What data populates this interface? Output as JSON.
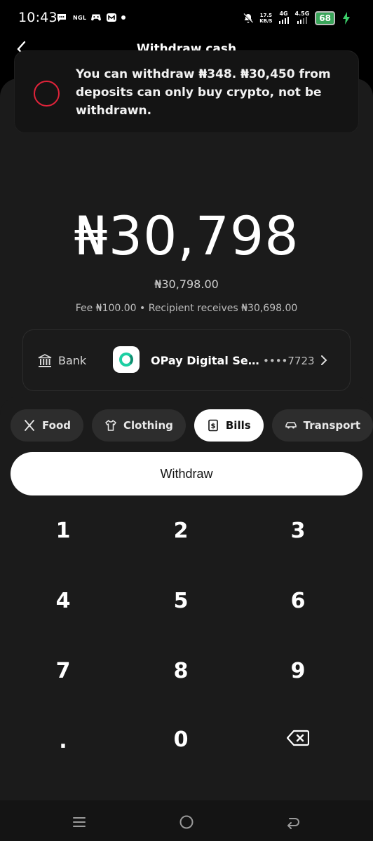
{
  "status_bar": {
    "time": "10:43",
    "notif_app": "NGL",
    "net_speed_value": "17.5",
    "net_speed_unit": "KB/S",
    "signal1": "4G",
    "signal2": "4.5G",
    "battery": "68"
  },
  "header": {
    "title": "Withdraw cash"
  },
  "toast": {
    "message": "You can withdraw ₦348. ₦30,450 from deposits can only buy crypto, not be withdrawn."
  },
  "amount": {
    "display": "₦30,798",
    "sub": "₦30,798.00",
    "fee_line": "Fee ₦100.00 • Recipient receives ₦30,698.00"
  },
  "bank": {
    "label": "Bank",
    "name": "OPay Digital Ser...",
    "account": "••••7723"
  },
  "categories": [
    {
      "label": "Food",
      "icon": "fork-knife-icon",
      "active": false
    },
    {
      "label": "Clothing",
      "icon": "shirt-icon",
      "active": false
    },
    {
      "label": "Bills",
      "icon": "bill-icon",
      "active": true
    },
    {
      "label": "Transport",
      "icon": "car-icon",
      "active": false
    }
  ],
  "withdraw_label": "Withdraw",
  "keypad": [
    "1",
    "2",
    "3",
    "4",
    "5",
    "6",
    "7",
    "8",
    "9",
    ".",
    "0",
    "backspace"
  ]
}
